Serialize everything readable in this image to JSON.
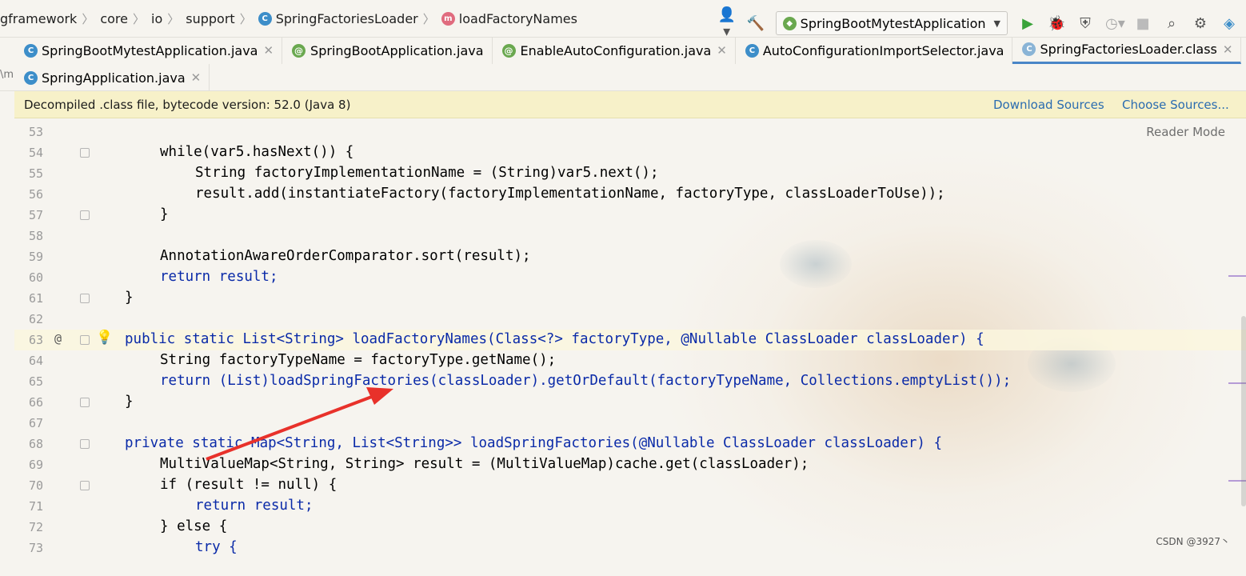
{
  "breadcrumb": {
    "items": [
      "gframework",
      "core",
      "io",
      "support",
      "SpringFactoriesLoader",
      "loadFactoryNames"
    ]
  },
  "toolbar": {
    "run_config": "SpringBootMytestApplication"
  },
  "tabs_row1": [
    {
      "label": "SpringBootMytestApplication.java",
      "icon": "class-icon",
      "closable": true,
      "active": false
    },
    {
      "label": "SpringBootApplication.java",
      "icon": "annotation-icon",
      "closable": false,
      "active": false
    },
    {
      "label": "EnableAutoConfiguration.java",
      "icon": "annotation-icon",
      "closable": true,
      "active": false
    },
    {
      "label": "AutoConfigurationImportSelector.java",
      "icon": "class-icon",
      "closable": false,
      "active": false
    },
    {
      "label": "SpringFactoriesLoader.class",
      "icon": "class-icon",
      "closable": true,
      "active": true
    }
  ],
  "tabs_row2": [
    {
      "label": "SpringApplication.java",
      "icon": "class-icon",
      "closable": true,
      "active": false
    }
  ],
  "banner": {
    "message": "Decompiled .class file, bytecode version: 52.0 (Java 8)",
    "download_sources": "Download Sources",
    "choose_sources": "Choose Sources..."
  },
  "reader_mode": "Reader Mode",
  "line_numbers": [
    "53",
    "54",
    "55",
    "56",
    "57",
    "58",
    "59",
    "60",
    "61",
    "62",
    "63",
    "64",
    "65",
    "66",
    "67",
    "68",
    "69",
    "70",
    "71",
    "72",
    "73"
  ],
  "code": {
    "l54": "while(var5.hasNext()) {",
    "l55": "String factoryImplementationName = (String)var5.next();",
    "l56": "result.add(instantiateFactory(factoryImplementationName, factoryType, classLoaderToUse));",
    "l57": "}",
    "l59": "AnnotationAwareOrderComparator.sort(result);",
    "l60": "return result;",
    "l61": "}",
    "l63": "public static List<String> loadFactoryNames(Class<?> factoryType, @Nullable ClassLoader classLoader) {",
    "l64": "String factoryTypeName = factoryType.getName();",
    "l65": "return (List)loadSpringFactories(classLoader).getOrDefault(factoryTypeName, Collections.emptyList());",
    "l66": "}",
    "l68": "private static Map<String, List<String>> loadSpringFactories(@Nullable ClassLoader classLoader) {",
    "l69": "MultiValueMap<String, String> result = (MultiValueMap)cache.get(classLoader);",
    "l70": "if (result != null) {",
    "l71": "return result;",
    "l72": "} else {",
    "l73": "try {"
  },
  "watermark": "CSDN @3927丶",
  "colors": {
    "keyword": "#0a2aa8",
    "annotation": "#808000",
    "method_decl": "#0a5cb8",
    "static_field": "#7a1ea1",
    "arrow": "#e8312a",
    "banner_bg": "#f7f1c9",
    "active_tab_underline": "#4a86c7"
  }
}
